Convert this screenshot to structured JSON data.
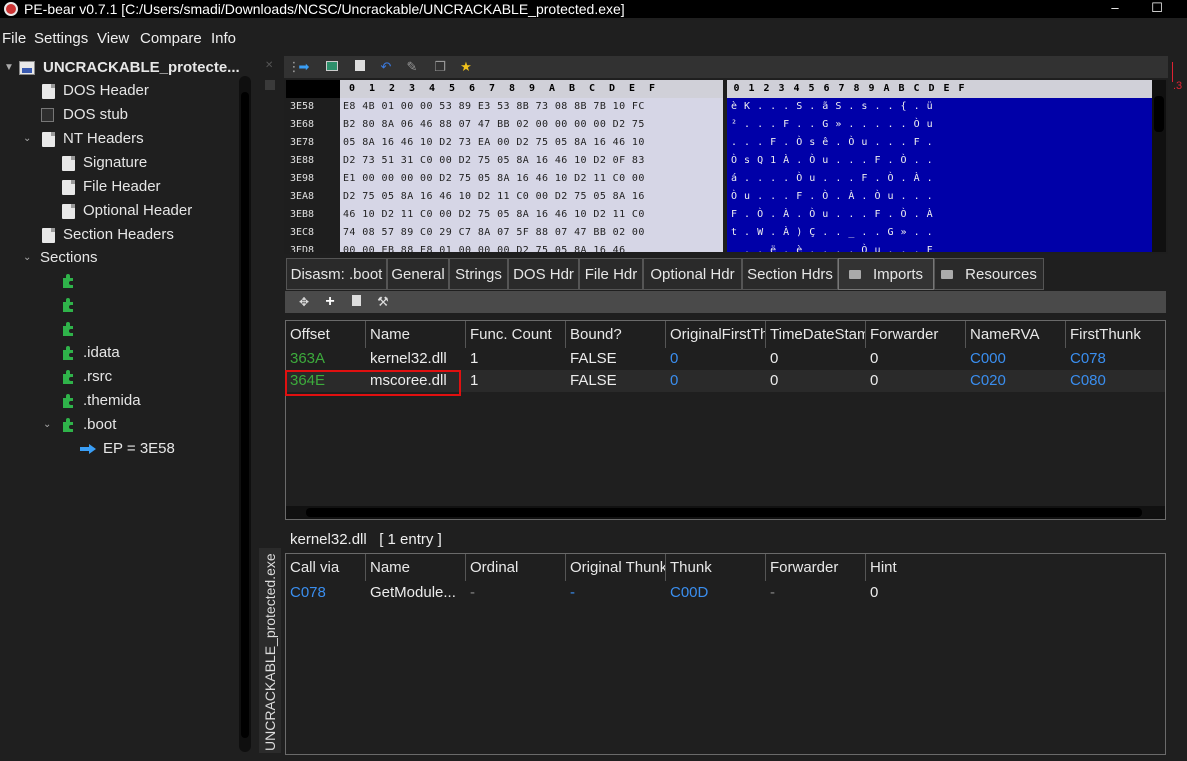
{
  "window": {
    "title": "PE-bear v0.7.1 [C:/Users/smadi/Downloads/NCSC/Uncrackable/UNCRACKABLE_protected.exe]",
    "minimize": "–",
    "maximize": "☐"
  },
  "menu": [
    "File",
    "Settings",
    "View",
    "Compare",
    "Info"
  ],
  "tree": {
    "root": "UNCRACKABLE_protecte...",
    "dos_header": "DOS Header",
    "dos_stub": "DOS stub",
    "nt_headers": "NT Headers",
    "signature": "Signature",
    "file_header": "File Header",
    "optional_header": "Optional Header",
    "section_headers": "Section Headers",
    "sections": "Sections",
    "section_items": [
      "",
      "",
      "",
      ".idata",
      ".rsrc",
      ".themida",
      ".boot"
    ],
    "ep": "EP = 3E58"
  },
  "vertical_tab": "UNCRACKABLE_protected.exe",
  "hex": {
    "columns": [
      "0",
      "1",
      "2",
      "3",
      "4",
      "5",
      "6",
      "7",
      "8",
      "9",
      "A",
      "B",
      "C",
      "D",
      "E",
      "F"
    ],
    "rows": [
      {
        "addr": "3E58",
        "hex": "E8 4B 01 00 00 53 89 E3 53 8B 73 08 8B 7B 10 FC",
        "ascii": "è K . . . S . ã S . s . . { . ü"
      },
      {
        "addr": "3E68",
        "hex": "B2 80 8A 06 46 88 07 47 BB 02 00 00 00 00 D2 75",
        "ascii": "² . . . F . . G » . . . . . Ò u"
      },
      {
        "addr": "3E78",
        "hex": "05 8A 16 46 10 D2 73 EA 00 D2 75 05 8A 16 46 10",
        "ascii": ". . . F . Ò s ê . Ò u . . . F ."
      },
      {
        "addr": "3E88",
        "hex": "D2 73 51 31 C0 00 D2 75 05 8A 16 46 10 D2 0F 83",
        "ascii": "Ò s Q 1 À . Ò u . . . F . Ò . ."
      },
      {
        "addr": "3E98",
        "hex": "E1 00 00 00 00 D2 75 05 8A 16 46 10 D2 11 C0 00",
        "ascii": "á . . . . Ò u . . . F . Ò . À ."
      },
      {
        "addr": "3EA8",
        "hex": "D2 75 05 8A 16 46 10 D2 11 C0 00 D2 75 05 8A 16",
        "ascii": "Ò u . . . F . Ò . À . Ò u . . ."
      },
      {
        "addr": "3EB8",
        "hex": "46 10 D2 11 C0 00 D2 75 05 8A 16 46 10 D2 11 C0",
        "ascii": "F . Ò . À . Ò u . . . F . Ò . À"
      },
      {
        "addr": "3EC8",
        "hex": "74 08 57 89 C0 29 C7 8A 07 5F 88 07 47 BB 02 00",
        "ascii": "t . W . À ) Ç . . _ . . G » . ."
      },
      {
        "addr": "3ED8",
        "hex": "00 00 EB 88 E8 01 00 00 00 D2 75 05 8A 16 46",
        "ascii": "  . . ë . è . . . . Ò u . . . F"
      }
    ]
  },
  "tabs": [
    "Disasm: .boot",
    "General",
    "Strings",
    "DOS Hdr",
    "File Hdr",
    "Optional Hdr",
    "Section Hdrs",
    "Imports",
    "Resources"
  ],
  "imports": {
    "columns": [
      "Offset",
      "Name",
      "Func. Count",
      "Bound?",
      "OriginalFirstThunk",
      "TimeDateStamp",
      "Forwarder",
      "NameRVA",
      "FirstThunk"
    ],
    "rows": [
      {
        "offset": "363A",
        "name": "kernel32.dll",
        "count": "1",
        "bound": "FALSE",
        "oft": "0",
        "tds": "0",
        "fwd": "0",
        "namerva": "C000",
        "ft": "C078"
      },
      {
        "offset": "364E",
        "name": "mscoree.dll",
        "count": "1",
        "bound": "FALSE",
        "oft": "0",
        "tds": "0",
        "fwd": "0",
        "namerva": "C020",
        "ft": "C080"
      }
    ]
  },
  "entries_caption": "kernel32.dll   [ 1 entry ]",
  "functions": {
    "columns": [
      "Call via",
      "Name",
      "Ordinal",
      "Original Thunk",
      "Thunk",
      "Forwarder",
      "Hint"
    ],
    "rows": [
      {
        "callvia": "C078",
        "name": "GetModule...",
        "ordinal": "-",
        "othunk": "-",
        "thunk": "C00D",
        "fwd": "-",
        "hint": "0"
      }
    ]
  },
  "colors": {
    "accent_blue": "#3a8eef",
    "offset_green": "#3cab3c",
    "highlight_red": "#e01010",
    "ascii_bg": "#0000a8"
  },
  "right_edge_mark": ".3"
}
